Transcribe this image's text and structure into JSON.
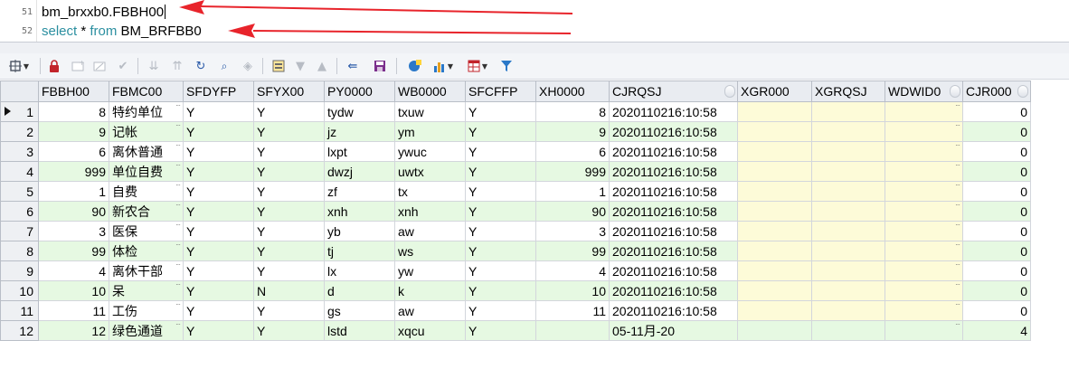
{
  "editor": {
    "lines": [
      {
        "number": "51",
        "text": "bm_brxxb0.FBBH00"
      },
      {
        "number": "52",
        "kw1": "select",
        "mid": " * ",
        "kw2": "from",
        "rest": " BM_BRFBB0"
      }
    ]
  },
  "toolbar": {
    "icons": [
      "grid-options-icon",
      "lock-icon",
      "add-record-icon",
      "delete-record-icon",
      "post-icon",
      "first-record-icon",
      "last-record-icon",
      "refresh-icon",
      "find-icon",
      "clear-icon",
      "query-by-example-icon",
      "filter-down-icon",
      "filter-up-icon",
      "link-icon",
      "save-icon",
      "export-icon",
      "chart-icon",
      "table-view-icon",
      "funnel-icon"
    ]
  },
  "grid": {
    "columns": [
      "FBBH00",
      "FBMC00",
      "SFDYFP",
      "SFYX00",
      "PY0000",
      "WB0000",
      "SFCFFP",
      "XH0000",
      "CJRQSJ",
      "XGR000",
      "XGRQSJ",
      "WDWID0",
      "CJR000"
    ],
    "rows": [
      {
        "n": "1",
        "fbbh": "8",
        "fbmc": "特约单位",
        "sfdyfp": "Y",
        "sfyx": "Y",
        "py": "tydw",
        "wb": "txuw",
        "sfcffp": "Y",
        "xh": "8",
        "cjrqsj": "2020110216:10:58",
        "xgr": "",
        "xgrqsj": "",
        "wdwid": "",
        "cjr": "0"
      },
      {
        "n": "2",
        "fbbh": "9",
        "fbmc": "记帐",
        "sfdyfp": "Y",
        "sfyx": "Y",
        "py": "jz",
        "wb": "ym",
        "sfcffp": "Y",
        "xh": "9",
        "cjrqsj": "2020110216:10:58",
        "xgr": "",
        "xgrqsj": "",
        "wdwid": "",
        "cjr": "0"
      },
      {
        "n": "3",
        "fbbh": "6",
        "fbmc": "离休普通",
        "sfdyfp": "Y",
        "sfyx": "Y",
        "py": "lxpt",
        "wb": "ywuc",
        "sfcffp": "Y",
        "xh": "6",
        "cjrqsj": "2020110216:10:58",
        "xgr": "",
        "xgrqsj": "",
        "wdwid": "",
        "cjr": "0"
      },
      {
        "n": "4",
        "fbbh": "999",
        "fbmc": "单位自费",
        "sfdyfp": "Y",
        "sfyx": "Y",
        "py": "dwzj",
        "wb": "uwtx",
        "sfcffp": "Y",
        "xh": "999",
        "cjrqsj": "2020110216:10:58",
        "xgr": "",
        "xgrqsj": "",
        "wdwid": "",
        "cjr": "0"
      },
      {
        "n": "5",
        "fbbh": "1",
        "fbmc": "自费",
        "sfdyfp": "Y",
        "sfyx": "Y",
        "py": "zf",
        "wb": "tx",
        "sfcffp": "Y",
        "xh": "1",
        "cjrqsj": "2020110216:10:58",
        "xgr": "",
        "xgrqsj": "",
        "wdwid": "",
        "cjr": "0"
      },
      {
        "n": "6",
        "fbbh": "90",
        "fbmc": "新农合",
        "sfdyfp": "Y",
        "sfyx": "Y",
        "py": "xnh",
        "wb": "xnh",
        "sfcffp": "Y",
        "xh": "90",
        "cjrqsj": "2020110216:10:58",
        "xgr": "",
        "xgrqsj": "",
        "wdwid": "",
        "cjr": "0"
      },
      {
        "n": "7",
        "fbbh": "3",
        "fbmc": "医保",
        "sfdyfp": "Y",
        "sfyx": "Y",
        "py": "yb",
        "wb": "aw",
        "sfcffp": "Y",
        "xh": "3",
        "cjrqsj": "2020110216:10:58",
        "xgr": "",
        "xgrqsj": "",
        "wdwid": "",
        "cjr": "0"
      },
      {
        "n": "8",
        "fbbh": "99",
        "fbmc": "体检",
        "sfdyfp": "Y",
        "sfyx": "Y",
        "py": "tj",
        "wb": "ws",
        "sfcffp": "Y",
        "xh": "99",
        "cjrqsj": "2020110216:10:58",
        "xgr": "",
        "xgrqsj": "",
        "wdwid": "",
        "cjr": "0"
      },
      {
        "n": "9",
        "fbbh": "4",
        "fbmc": "离休干部",
        "sfdyfp": "Y",
        "sfyx": "Y",
        "py": "lx",
        "wb": "yw",
        "sfcffp": "Y",
        "xh": "4",
        "cjrqsj": "2020110216:10:58",
        "xgr": "",
        "xgrqsj": "",
        "wdwid": "",
        "cjr": "0"
      },
      {
        "n": "10",
        "fbbh": "10",
        "fbmc": "呆",
        "sfdyfp": "Y",
        "sfyx": "N",
        "py": "d",
        "wb": "k",
        "sfcffp": "Y",
        "xh": "10",
        "cjrqsj": "2020110216:10:58",
        "xgr": "",
        "xgrqsj": "",
        "wdwid": "",
        "cjr": "0"
      },
      {
        "n": "11",
        "fbbh": "11",
        "fbmc": "工伤",
        "sfdyfp": "Y",
        "sfyx": "Y",
        "py": "gs",
        "wb": "aw",
        "sfcffp": "Y",
        "xh": "11",
        "cjrqsj": "2020110216:10:58",
        "xgr": "",
        "xgrqsj": "",
        "wdwid": "",
        "cjr": "0"
      },
      {
        "n": "12",
        "fbbh": "12",
        "fbmc": "绿色通道",
        "sfdyfp": "Y",
        "sfyx": "Y",
        "py": "lstd",
        "wb": "xqcu",
        "sfcffp": "Y",
        "xh": "",
        "cjrqsj": "05-11月-20",
        "xgr": "",
        "xgrqsj": "",
        "wdwid": "",
        "cjr": "4"
      }
    ]
  },
  "colors": {
    "annotation_arrow": "#e8242b",
    "even_row": "#e6f9e2",
    "empty_cell": "#fdfbd8",
    "keyword": "#2b8fa0"
  }
}
